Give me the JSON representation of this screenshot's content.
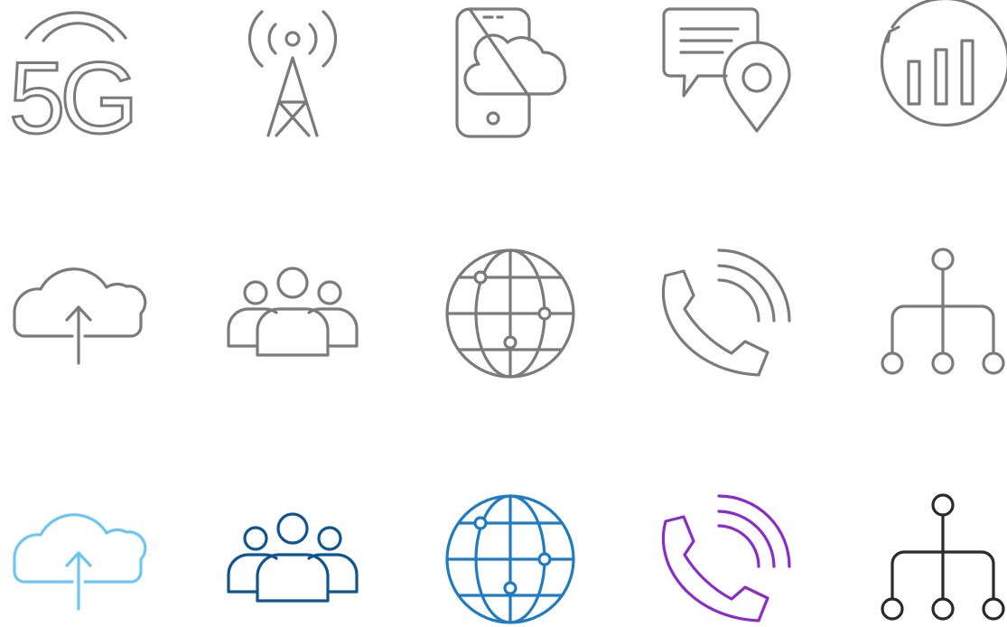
{
  "colors": {
    "gray": "#7b7b7b",
    "light_blue": "#6cc6f3",
    "navy": "#0f5590",
    "blue": "#1f7bc3",
    "purple": "#8a2cc8",
    "dark": "#2a2a2a"
  },
  "icons": {
    "row1": [
      {
        "name": "5g-signal-icon",
        "text": "5G",
        "color": "gray"
      },
      {
        "name": "cell-tower-icon",
        "color": "gray"
      },
      {
        "name": "phone-cloud-icon",
        "color": "gray"
      },
      {
        "name": "chat-location-icon",
        "color": "gray"
      },
      {
        "name": "refresh-bar-chart-icon",
        "color": "gray"
      }
    ],
    "row2": [
      {
        "name": "cloud-upload-icon",
        "color": "gray"
      },
      {
        "name": "group-icon",
        "color": "gray"
      },
      {
        "name": "globe-network-icon",
        "color": "gray"
      },
      {
        "name": "phone-call-icon",
        "color": "gray"
      },
      {
        "name": "hierarchy-icon",
        "color": "gray"
      }
    ],
    "row3": [
      {
        "name": "cloud-upload-icon",
        "color": "light_blue"
      },
      {
        "name": "group-icon",
        "color": "navy"
      },
      {
        "name": "globe-network-icon",
        "color": "blue"
      },
      {
        "name": "phone-call-icon",
        "color": "purple"
      },
      {
        "name": "hierarchy-icon",
        "color": "dark"
      }
    ]
  }
}
